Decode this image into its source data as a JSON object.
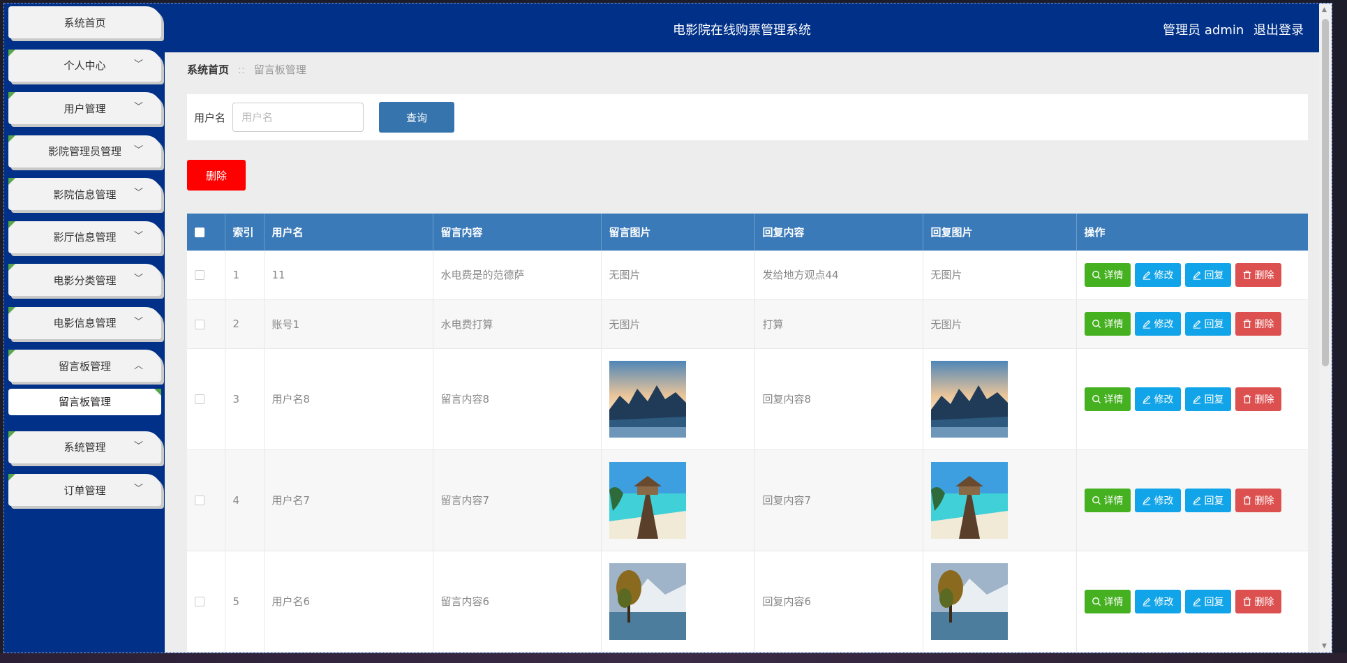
{
  "header": {
    "title": "电影院在线购票管理系统",
    "user_label": "管理员 admin",
    "logout_label": "退出登录"
  },
  "sidebar": {
    "items": [
      {
        "label": "系统首页",
        "expandable": false
      },
      {
        "label": "个人中心",
        "expandable": true
      },
      {
        "label": "用户管理",
        "expandable": true
      },
      {
        "label": "影院管理员管理",
        "expandable": true
      },
      {
        "label": "影院信息管理",
        "expandable": true
      },
      {
        "label": "影厅信息管理",
        "expandable": true
      },
      {
        "label": "电影分类管理",
        "expandable": true
      },
      {
        "label": "电影信息管理",
        "expandable": true
      },
      {
        "label": "留言板管理",
        "expandable": true,
        "expanded": true
      },
      {
        "label": "系统管理",
        "expandable": true
      },
      {
        "label": "订单管理",
        "expandable": true
      }
    ],
    "sub_item": "留言板管理"
  },
  "breadcrumb": {
    "home": "系统首页",
    "separator": "::",
    "current": "留言板管理"
  },
  "search": {
    "label": "用户名",
    "placeholder": "用户名",
    "value": "",
    "button": "查询"
  },
  "delete_button": "删除",
  "table": {
    "columns": [
      "索引",
      "用户名",
      "留言内容",
      "留言图片",
      "回复内容",
      "回复图片",
      "操作"
    ],
    "rows": [
      {
        "index": "1",
        "username": "11",
        "content": "水电费是的范德萨",
        "image": "无图片",
        "reply": "发给地方观点44",
        "reply_image": "无图片"
      },
      {
        "index": "2",
        "username": "账号1",
        "content": "水电费打算",
        "image": "无图片",
        "reply": "打算",
        "reply_image": "无图片"
      },
      {
        "index": "3",
        "username": "用户名8",
        "content": "留言内容8",
        "image": "mountain-sunset",
        "reply": "回复内容8",
        "reply_image": "mountain-sunset"
      },
      {
        "index": "4",
        "username": "用户名7",
        "content": "留言内容7",
        "image": "beach-pier",
        "reply": "回复内容7",
        "reply_image": "beach-pier"
      },
      {
        "index": "5",
        "username": "用户名6",
        "content": "留言内容6",
        "image": "lake-tree",
        "reply": "回复内容6",
        "reply_image": "lake-tree"
      }
    ],
    "actions": {
      "detail": "详情",
      "edit": "修改",
      "reply": "回复",
      "remove": "删除"
    }
  },
  "colors": {
    "brand": "#003087",
    "table_header": "#3a7ab8",
    "detail": "#45b020",
    "edit": "#12a4e8",
    "remove": "#dd5050",
    "delete_batch": "#ff0000"
  }
}
